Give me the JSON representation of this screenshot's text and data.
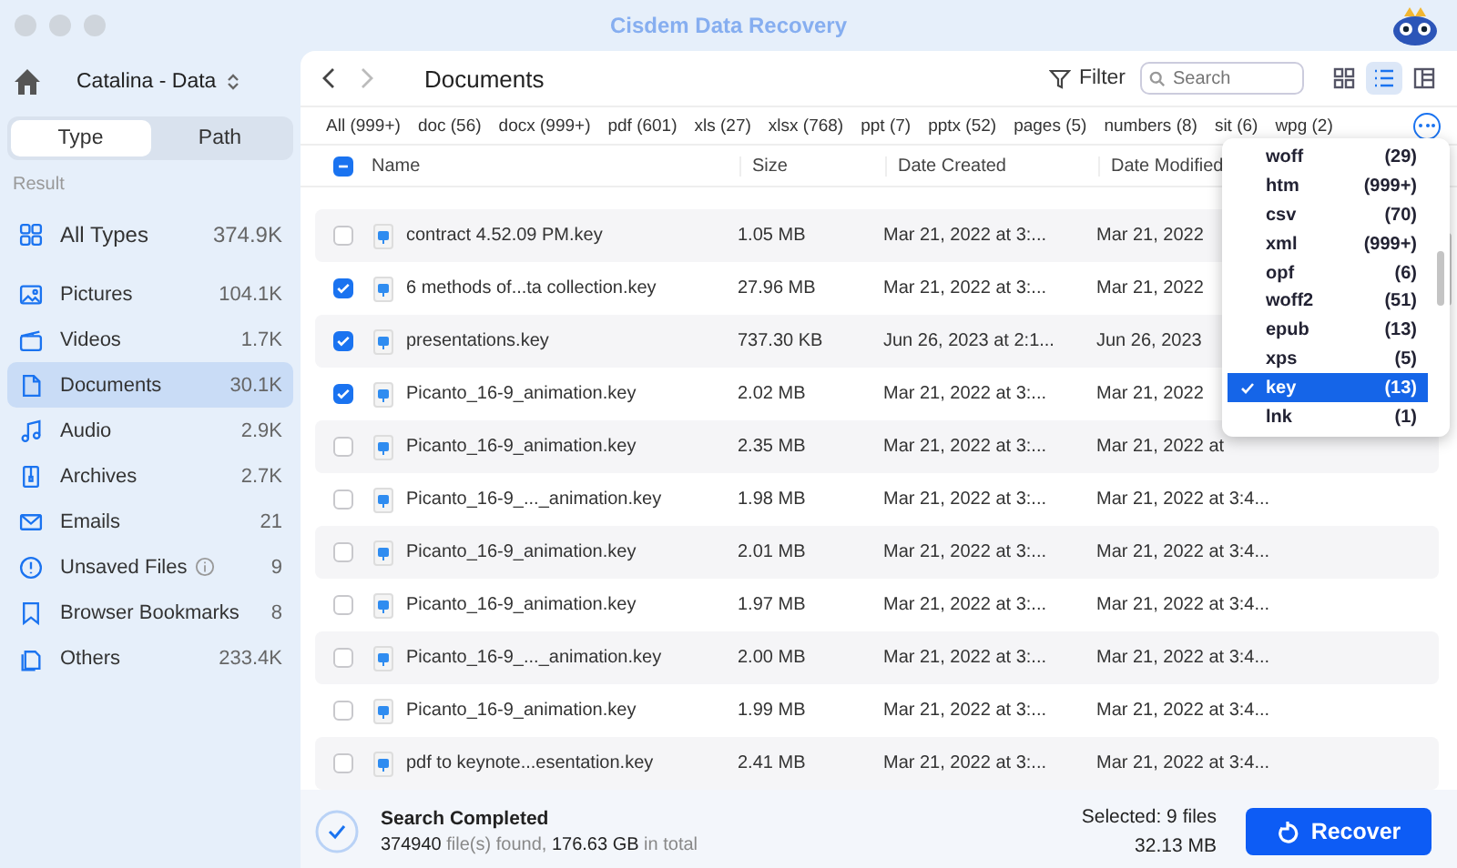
{
  "window": {
    "title": "Cisdem Data Recovery"
  },
  "sidebar": {
    "volume": "Catalina - Data",
    "tabs": [
      {
        "label": "Type",
        "selected": true
      },
      {
        "label": "Path",
        "selected": false
      }
    ],
    "section": "Result",
    "items": [
      {
        "kind": "all",
        "label": "All Types",
        "count": "374.9K",
        "selected": false
      },
      {
        "kind": "pictures",
        "label": "Pictures",
        "count": "104.1K",
        "selected": false
      },
      {
        "kind": "videos",
        "label": "Videos",
        "count": "1.7K",
        "selected": false
      },
      {
        "kind": "documents",
        "label": "Documents",
        "count": "30.1K",
        "selected": true
      },
      {
        "kind": "audio",
        "label": "Audio",
        "count": "2.9K",
        "selected": false
      },
      {
        "kind": "archives",
        "label": "Archives",
        "count": "2.7K",
        "selected": false
      },
      {
        "kind": "emails",
        "label": "Emails",
        "count": "21",
        "selected": false
      },
      {
        "kind": "unsaved",
        "label": "Unsaved Files",
        "count": "9",
        "selected": false,
        "info": true
      },
      {
        "kind": "bookmarks",
        "label": "Browser Bookmarks",
        "count": "8",
        "selected": false
      },
      {
        "kind": "others",
        "label": "Others",
        "count": "233.4K",
        "selected": false
      }
    ]
  },
  "toolbar": {
    "title": "Documents",
    "filter": "Filter",
    "search": {
      "placeholder": "Search"
    },
    "views": [
      {
        "kind": "grid",
        "selected": false
      },
      {
        "kind": "list",
        "selected": true
      },
      {
        "kind": "columns",
        "selected": false
      }
    ]
  },
  "type_filters": [
    "All (999+)",
    "doc (56)",
    "docx (999+)",
    "pdf (601)",
    "xls (27)",
    "xlsx (768)",
    "ppt (7)",
    "pptx (52)",
    "pages (5)",
    "numbers (8)",
    "sit (6)",
    "wpg (2)"
  ],
  "table": {
    "partially_checked": true,
    "columns": [
      "Name",
      "Size",
      "Date Created",
      "Date Modified"
    ],
    "rows": [
      {
        "name": "contract 4.52.09 PM.key",
        "size": "1.05 MB",
        "created": "Mar 21, 2022 at 3:...",
        "modified": "Mar 21, 2022",
        "checked": false
      },
      {
        "name": "6 methods of...ta collection.key",
        "size": "27.96 MB",
        "created": "Mar 21, 2022 at 3:...",
        "modified": "Mar 21, 2022",
        "checked": true
      },
      {
        "name": "presentations.key",
        "size": "737.30 KB",
        "created": "Jun 26, 2023 at 2:1...",
        "modified": "Jun 26, 2023",
        "checked": true
      },
      {
        "name": "Picanto_16-9_animation.key",
        "size": "2.02 MB",
        "created": "Mar 21, 2022 at 3:...",
        "modified": "Mar 21, 2022",
        "checked": true
      },
      {
        "name": "Picanto_16-9_animation.key",
        "size": "2.35 MB",
        "created": "Mar 21, 2022 at 3:...",
        "modified": "Mar 21, 2022 at",
        "checked": false
      },
      {
        "name": "Picanto_16-9_..._animation.key",
        "size": "1.98 MB",
        "created": "Mar 21, 2022 at 3:...",
        "modified": "Mar 21, 2022 at 3:4...",
        "checked": false
      },
      {
        "name": "Picanto_16-9_animation.key",
        "size": "2.01 MB",
        "created": "Mar 21, 2022 at 3:...",
        "modified": "Mar 21, 2022 at 3:4...",
        "checked": false
      },
      {
        "name": "Picanto_16-9_animation.key",
        "size": "1.97 MB",
        "created": "Mar 21, 2022 at 3:...",
        "modified": "Mar 21, 2022 at 3:4...",
        "checked": false
      },
      {
        "name": "Picanto_16-9_..._animation.key",
        "size": "2.00 MB",
        "created": "Mar 21, 2022 at 3:...",
        "modified": "Mar 21, 2022 at 3:4...",
        "checked": false
      },
      {
        "name": "Picanto_16-9_animation.key",
        "size": "1.99 MB",
        "created": "Mar 21, 2022 at 3:...",
        "modified": "Mar 21, 2022 at 3:4...",
        "checked": false
      },
      {
        "name": "pdf to keynote...esentation.key",
        "size": "2.41 MB",
        "created": "Mar 21, 2022 at 3:...",
        "modified": "Mar 21, 2022 at 3:4...",
        "checked": false
      }
    ]
  },
  "type_menu": [
    {
      "label": "woff",
      "count": "(29)",
      "selected": false
    },
    {
      "label": "htm",
      "count": "(999+)",
      "selected": false
    },
    {
      "label": "csv",
      "count": "(70)",
      "selected": false
    },
    {
      "label": "xml",
      "count": "(999+)",
      "selected": false
    },
    {
      "label": "opf",
      "count": "(6)",
      "selected": false
    },
    {
      "label": "woff2",
      "count": "(51)",
      "selected": false
    },
    {
      "label": "epub",
      "count": "(13)",
      "selected": false
    },
    {
      "label": "xps",
      "count": "(5)",
      "selected": false
    },
    {
      "label": "key",
      "count": "(13)",
      "selected": true
    },
    {
      "label": "lnk",
      "count": "(1)",
      "selected": false
    }
  ],
  "status": {
    "title": "Search Completed",
    "summary": "**374940** file(s) found, **176.63 GB** in total",
    "selected": "Selected: 9 files",
    "selected_size": "32.13 MB",
    "recover": "Recover"
  }
}
